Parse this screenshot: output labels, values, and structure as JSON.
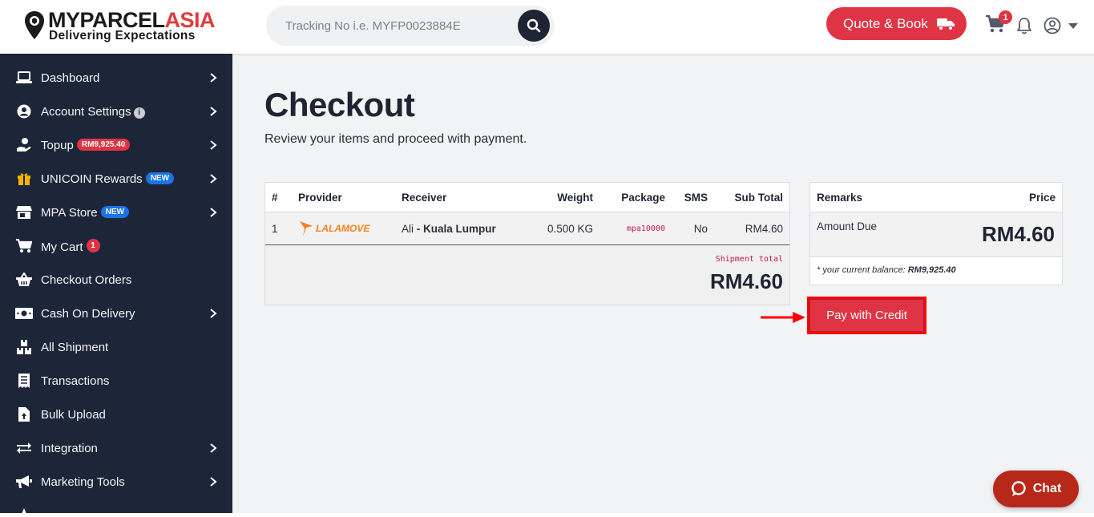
{
  "header": {
    "logo_brand_a": "MYPARCEL",
    "logo_brand_b": "ASIA",
    "logo_tagline": "Delivering Expectations",
    "search_placeholder": "Tracking No i.e. MYFP0023884E",
    "quote_label": "Quote & Book",
    "cart_count": "1",
    "accent_color": "#e03444"
  },
  "sidebar": {
    "items": [
      {
        "label": "Dashboard",
        "icon": "laptop-icon",
        "chevron": true
      },
      {
        "label": "Account Settings",
        "icon": "user-circle-icon",
        "chevron": true,
        "info": "i"
      },
      {
        "label": "Topup",
        "icon": "hand-coin-icon",
        "chevron": true,
        "badge": "RM9,925.40"
      },
      {
        "label": "UNICOIN Rewards",
        "icon": "gift-icon",
        "chevron": true,
        "badge": "NEW"
      },
      {
        "label": "MPA Store",
        "icon": "store-icon",
        "chevron": true,
        "badge": "NEW"
      },
      {
        "label": "My Cart",
        "icon": "cart-icon",
        "chevron": false,
        "badge": "1"
      },
      {
        "label": "Checkout Orders",
        "icon": "basket-icon",
        "chevron": false
      },
      {
        "label": "Cash On Delivery",
        "icon": "money-icon",
        "chevron": true
      },
      {
        "label": "All Shipment",
        "icon": "boxes-icon",
        "chevron": false
      },
      {
        "label": "Transactions",
        "icon": "receipt-icon",
        "chevron": false
      },
      {
        "label": "Bulk Upload",
        "icon": "file-upload-icon",
        "chevron": false
      },
      {
        "label": "Integration",
        "icon": "exchange-icon",
        "chevron": true
      },
      {
        "label": "Marketing Tools",
        "icon": "megaphone-icon",
        "chevron": true
      }
    ]
  },
  "main": {
    "title": "Checkout",
    "subtitle": "Review your items and proceed with payment."
  },
  "order_table": {
    "headers": [
      "#",
      "Provider",
      "Receiver",
      "Weight",
      "Package",
      "SMS",
      "Sub Total"
    ],
    "row": {
      "index": "1",
      "provider": "LALAMOVE",
      "receiver_name": "Ali",
      "receiver_sep": " - ",
      "receiver_city": "Kuala Lumpur",
      "weight": "0.500 KG",
      "package": "mpa10000",
      "sms": "No",
      "subtotal": "RM4.60"
    },
    "shipment_total_label": "Shipment total",
    "shipment_total": "RM4.60"
  },
  "summary": {
    "remarks_header": "Remarks",
    "price_header": "Price",
    "amount_due_label": "Amount Due",
    "amount_due": "RM4.60",
    "balance_prefix": "* your current balance: ",
    "balance_value": "RM9,925.40"
  },
  "pay_button_label": "Pay with Credit",
  "chat_label": "Chat"
}
